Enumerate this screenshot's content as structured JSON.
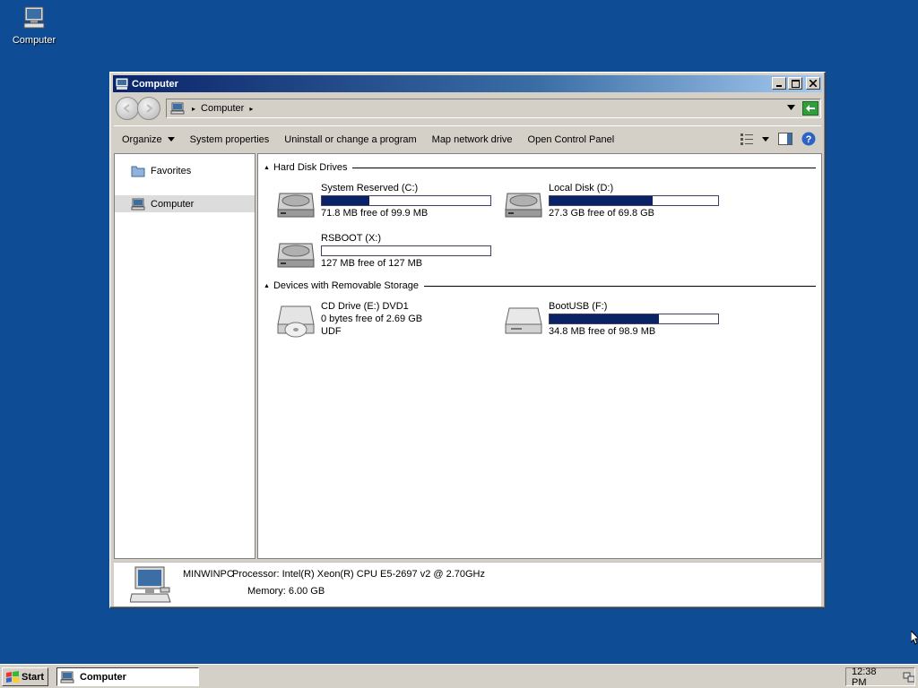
{
  "desktop": {
    "icon_label": "Computer"
  },
  "window": {
    "title": "Computer",
    "address": {
      "crumb": "Computer"
    },
    "commands": {
      "organize": "Organize",
      "system_properties": "System properties",
      "uninstall": "Uninstall or change a program",
      "map_drive": "Map network drive",
      "control_panel": "Open Control Panel"
    },
    "nav": {
      "favorites": "Favorites",
      "computer": "Computer"
    },
    "groups": {
      "hard_disks": "Hard Disk Drives",
      "removable": "Devices with Removable Storage"
    },
    "drives": [
      {
        "name": "System Reserved (C:)",
        "info": "71.8 MB free of 99.9 MB",
        "used_fraction": 0.28
      },
      {
        "name": "Local Disk (D:)",
        "info": "27.3 GB free of 69.8 GB",
        "used_fraction": 0.61
      },
      {
        "name": "RSBOOT (X:)",
        "info": "127 MB free of 127 MB",
        "used_fraction": 0.0
      },
      {
        "name": "CD Drive (E:) DVD1",
        "line2": "0 bytes free of 2.69 GB",
        "line3": "UDF"
      },
      {
        "name": "BootUSB (F:)",
        "info": "34.8 MB free of 98.9 MB",
        "used_fraction": 0.65
      }
    ],
    "details": {
      "pc_name": "MINWINPC",
      "processor": "Processor: Intel(R) Xeon(R) CPU E5-2697 v2 @ 2.70GHz",
      "memory": "Memory: 6.00 GB"
    }
  },
  "taskbar": {
    "start_label": "Start",
    "task_label": "Computer",
    "clock": "12:38 PM"
  },
  "colors": {
    "desktop": "#0f4c96",
    "bar_fill": "#0a2266",
    "title_gradient_start": "#0a246a"
  }
}
